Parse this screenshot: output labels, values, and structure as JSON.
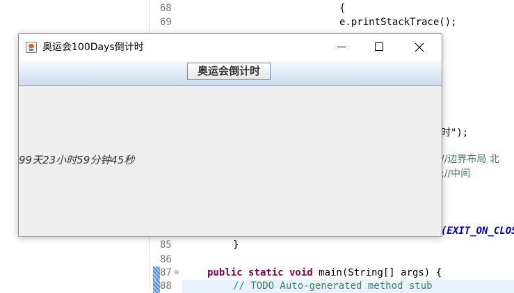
{
  "editor": {
    "lines": [
      {
        "num": "68",
        "code": "{",
        "indent": 488
      },
      {
        "num": "69",
        "code": "e.printStackTrace();",
        "indent": 488
      },
      {
        "num": "85",
        "code": "}",
        "indent": 335
      },
      {
        "num": "86",
        "code": "",
        "indent": 335
      },
      {
        "num": "87",
        "kw": "public static void",
        "code": " main(String[] args) {",
        "indent": 298
      },
      {
        "num": "88",
        "code": "// TODO Auto-generated method stub",
        "indent": 335
      }
    ],
    "fragments": {
      "frag1": "时\");",
      "frag2": "//边界布局 北",
      "frag3": ";//中间",
      "frag4": "(EXIT_ON_CLOS"
    }
  },
  "window": {
    "title": "奥运会100Days倒计时",
    "button_label": "奥运会倒计时",
    "countdown_text": "99天23小时59分钟45秒"
  }
}
